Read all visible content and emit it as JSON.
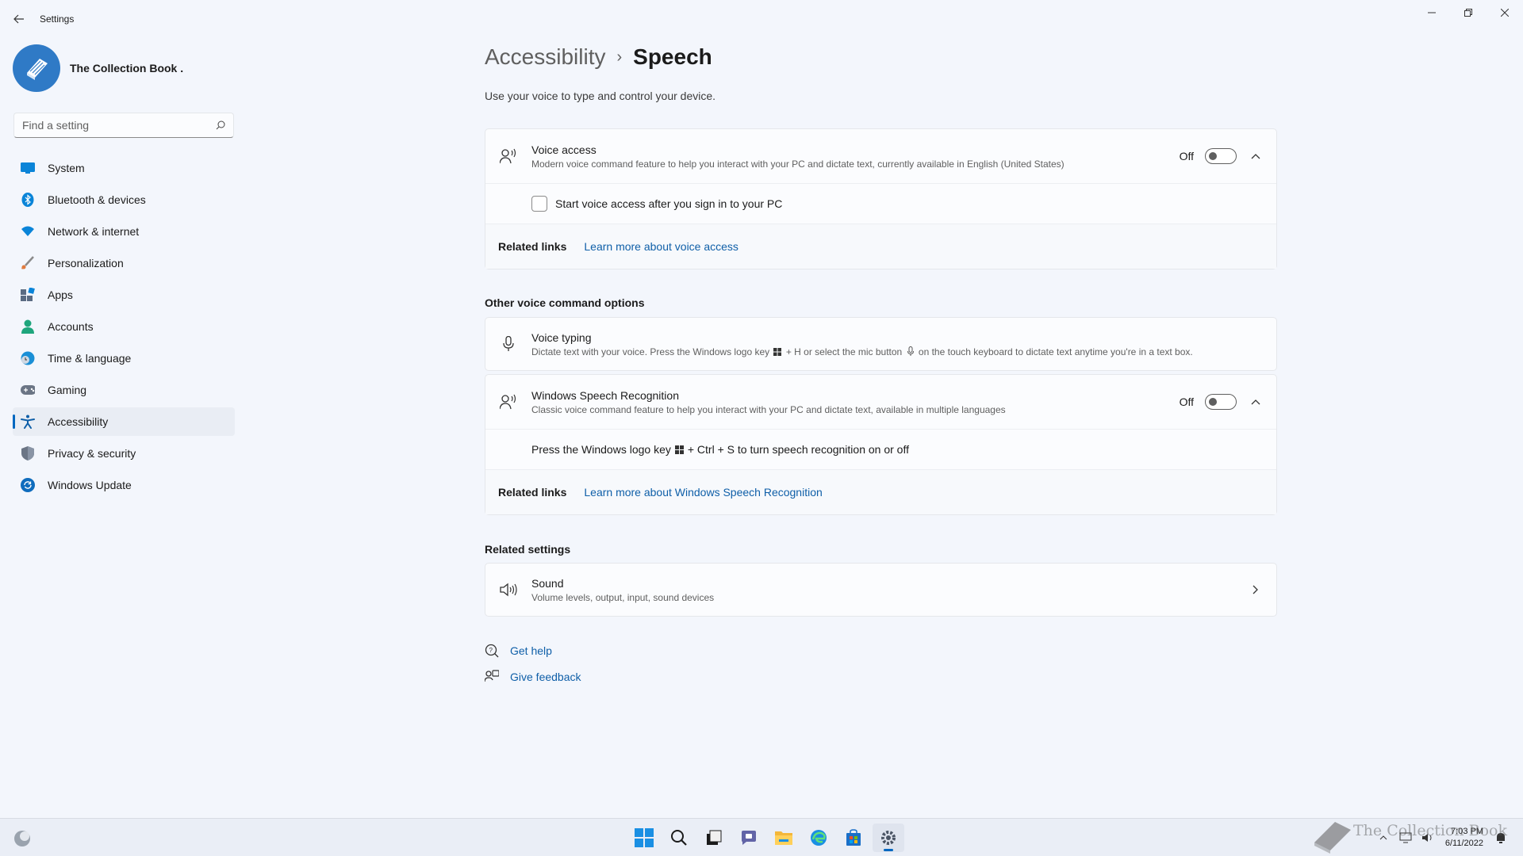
{
  "window": {
    "title": "Settings",
    "controls": [
      "minimize",
      "restore",
      "close"
    ]
  },
  "profile": {
    "name": "The Collection Book ."
  },
  "search": {
    "placeholder": "Find a setting"
  },
  "sidebar": {
    "items": [
      {
        "label": "System",
        "icon": "monitor-icon",
        "color": "#0078d4"
      },
      {
        "label": "Bluetooth & devices",
        "icon": "bluetooth-icon",
        "color": "#0078d4"
      },
      {
        "label": "Network & internet",
        "icon": "wifi-icon",
        "color": "#0078d4"
      },
      {
        "label": "Personalization",
        "icon": "brush-icon",
        "color": "#e07a3e"
      },
      {
        "label": "Apps",
        "icon": "apps-icon",
        "color": "#5a6b82"
      },
      {
        "label": "Accounts",
        "icon": "person-icon",
        "color": "#1ea57c"
      },
      {
        "label": "Time & language",
        "icon": "globe-clock-icon",
        "color": "#0e84c8"
      },
      {
        "label": "Gaming",
        "icon": "gamepad-icon",
        "color": "#6b7585"
      },
      {
        "label": "Accessibility",
        "icon": "accessibility-icon",
        "color": "#0f5fa8",
        "active": true
      },
      {
        "label": "Privacy & security",
        "icon": "shield-icon",
        "color": "#6b7585"
      },
      {
        "label": "Windows Update",
        "icon": "update-icon",
        "color": "#0f6cbd"
      }
    ]
  },
  "header": {
    "parent": "Accessibility",
    "separator": "›",
    "current": "Speech",
    "description": "Use your voice to type and control your device."
  },
  "voice_access": {
    "title": "Voice access",
    "subtitle": "Modern voice command feature to help you interact with your PC and dictate text, currently available in English (United States)",
    "toggle_state": "Off",
    "checkbox_label": "Start voice access after you sign in to your PC",
    "related_label": "Related links",
    "related_link": "Learn more about voice access"
  },
  "other_options": {
    "section_title": "Other voice command options",
    "voice_typing": {
      "title": "Voice typing",
      "subtitle_part1": "Dictate text with your voice. Press the Windows logo key",
      "subtitle_part2": "+ H or select the mic button",
      "subtitle_part3": "on the touch keyboard to dictate text anytime you're in a text box."
    },
    "speech_recognition": {
      "title": "Windows Speech Recognition",
      "subtitle": "Classic voice command feature to help you interact with your PC and dictate text, available in multiple languages",
      "toggle_state": "Off",
      "hint_part1": "Press the Windows logo key",
      "hint_part2": "+ Ctrl + S to turn speech recognition on or off",
      "related_label": "Related links",
      "related_link": "Learn more about Windows Speech Recognition"
    }
  },
  "related_settings": {
    "section_title": "Related settings",
    "sound": {
      "title": "Sound",
      "subtitle": "Volume levels, output, input, sound devices"
    }
  },
  "help": {
    "get_help": "Get help",
    "give_feedback": "Give feedback"
  },
  "taskbar": {
    "apps": [
      "start-icon",
      "search-icon",
      "task-view-icon",
      "chat-icon",
      "file-explorer-icon",
      "edge-icon",
      "store-icon",
      "settings-icon"
    ],
    "time": "7:03 PM",
    "date": "6/11/2022",
    "watermark": "The Collection Book"
  }
}
